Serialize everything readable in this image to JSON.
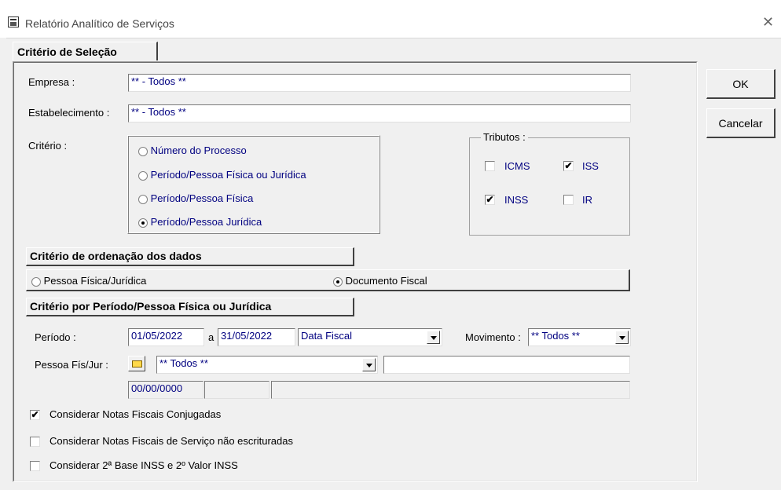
{
  "window": {
    "title": "Relatório Analítico de Serviços"
  },
  "tabs": {
    "selection": "Critério de Seleção"
  },
  "form": {
    "empresa_label": "Empresa :",
    "empresa_value": "** - Todos    **",
    "estabelecimento_label": "Estabelecimento :",
    "estabelecimento_value": "** - Todos    **",
    "criterio_label": "Critério :",
    "criterio_options": [
      "Número do Processo",
      "Período/Pessoa Física ou Jurídica",
      "Período/Pessoa Física",
      "Período/Pessoa Jurídica"
    ],
    "criterio_selected": "Período/Pessoa Jurídica"
  },
  "tributos": {
    "label": "Tributos :",
    "icms": {
      "label": "ICMS",
      "checked": false
    },
    "iss": {
      "label": "ISS",
      "checked": true
    },
    "inss": {
      "label": "INSS",
      "checked": true
    },
    "ir": {
      "label": "IR",
      "checked": false
    }
  },
  "ordenacao": {
    "title": "Critério de ordenação dos dados",
    "options": [
      "Pessoa Física/Jurídica",
      "Documento Fiscal"
    ],
    "selected": "Documento Fiscal"
  },
  "periodo_section": {
    "title": "Critério por Período/Pessoa Física ou Jurídica",
    "periodo_label": "Período :",
    "date_from": "01/05/2022",
    "a_label": "a",
    "date_to": "31/05/2022",
    "date_type": "Data Fiscal",
    "movimento_label": "Movimento :",
    "movimento_value": "** Todos **",
    "pessoa_label": "Pessoa Fís/Jur :",
    "pessoa_value": "** Todos **",
    "pessoa_date": "00/00/0000"
  },
  "options": {
    "conjugadas": {
      "label": "Considerar Notas Fiscais Conjugadas",
      "checked": true
    },
    "nao_escrituradas": {
      "label": "Considerar Notas Fiscais de Serviço não escrituradas",
      "checked": false
    },
    "segunda_base": {
      "label": "Considerar 2ª Base INSS e 2º Valor INSS",
      "checked": false
    }
  },
  "buttons": {
    "ok": "OK",
    "cancel": "Cancelar"
  },
  "icons": {
    "app": "report-icon",
    "close": "close-icon",
    "folder": "folder-open-icon"
  }
}
